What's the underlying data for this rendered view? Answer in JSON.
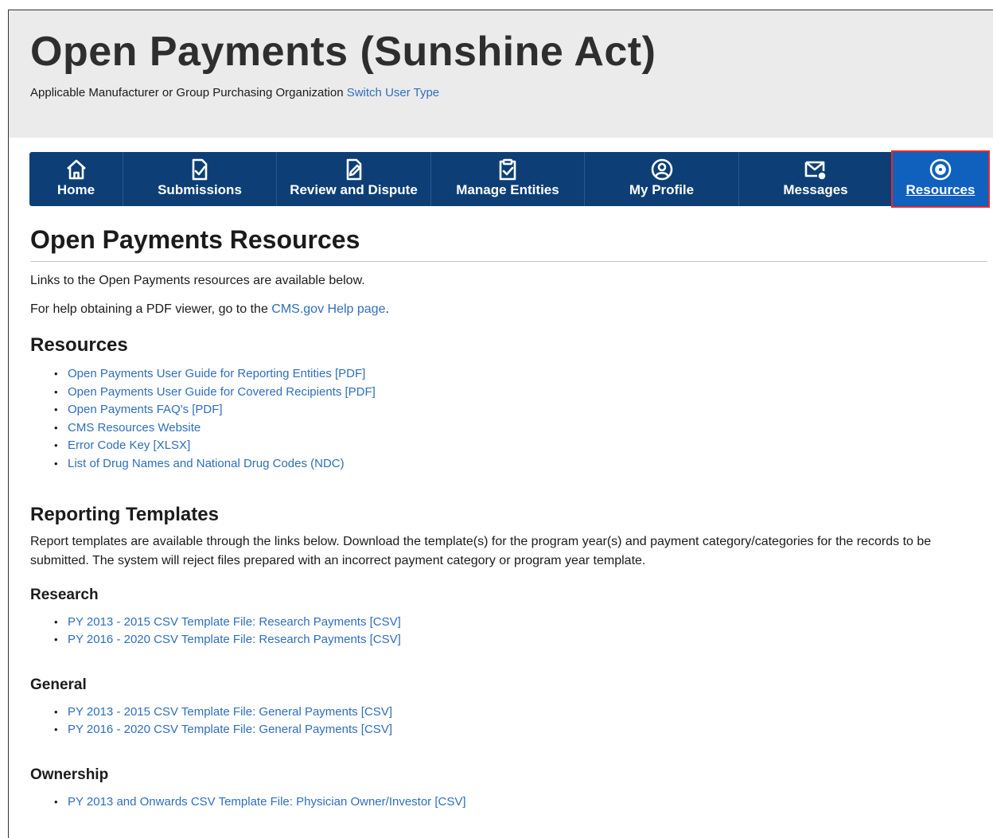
{
  "header": {
    "title": "Open Payments (Sunshine Act)",
    "user_type": "Applicable Manufacturer or Group Purchasing Organization",
    "switch_link": "Switch User Type"
  },
  "nav": {
    "items": [
      {
        "label": "Home",
        "icon": "home-icon"
      },
      {
        "label": "Submissions",
        "icon": "submissions-icon"
      },
      {
        "label": "Review and Dispute",
        "icon": "edit-document-icon"
      },
      {
        "label": "Manage Entities",
        "icon": "clipboard-check-icon"
      },
      {
        "label": "My Profile",
        "icon": "user-circle-icon"
      },
      {
        "label": "Messages",
        "icon": "envelope-icon"
      },
      {
        "label": "Resources",
        "icon": "gear-circle-icon",
        "active": true
      }
    ]
  },
  "main": {
    "title": "Open Payments Resources",
    "intro": "Links to the Open Payments resources are available below.",
    "help_prefix": "For help obtaining a PDF viewer, go to the ",
    "help_link": "CMS.gov Help page",
    "help_suffix": ".",
    "resources_heading": "Resources",
    "resources": [
      "Open Payments User Guide for Reporting Entities [PDF]",
      "Open Payments User Guide for Covered Recipients [PDF]",
      "Open Payments FAQ's [PDF]",
      "CMS Resources Website",
      "Error Code Key [XLSX]",
      "List of Drug Names and National Drug Codes (NDC)"
    ],
    "templates_heading": "Reporting Templates",
    "templates_text": "Report templates are available through the links below. Download the template(s) for the program year(s) and payment category/categories for the records to be submitted. The system will reject files prepared with an incorrect payment category or program year template.",
    "research_heading": "Research",
    "research": [
      "PY 2013 - 2015 CSV Template File: Research Payments [CSV]",
      "PY 2016 - 2020 CSV Template File: Research Payments [CSV]"
    ],
    "general_heading": "General",
    "general": [
      "PY 2013 - 2015 CSV Template File: General Payments [CSV]",
      "PY 2016 - 2020 CSV Template File: General Payments [CSV]"
    ],
    "ownership_heading": "Ownership",
    "ownership": [
      "PY 2013 and Onwards CSV Template File: Physician Owner/Investor [CSV]"
    ]
  },
  "colors": {
    "nav_bg": "#0d3f76",
    "nav_active": "#1060bd",
    "link": "#2e6ebd",
    "highlight_box": "#e02b2b"
  }
}
